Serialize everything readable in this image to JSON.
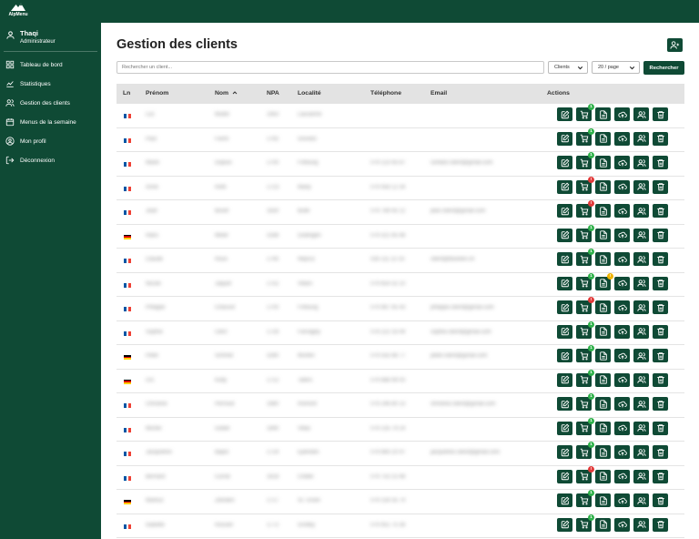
{
  "app": {
    "logo_text": "AlpMenu"
  },
  "user": {
    "name": "Thaqi",
    "role": "Administrateur"
  },
  "nav": [
    {
      "label": "Tableau de bord",
      "icon": "dashboard-icon"
    },
    {
      "label": "Statistiques",
      "icon": "chart-icon"
    },
    {
      "label": "Gestion des clients",
      "icon": "users-icon"
    },
    {
      "label": "Menus de la semaine",
      "icon": "calendar-icon"
    },
    {
      "label": "Mon profil",
      "icon": "profile-icon"
    },
    {
      "label": "Déconnexion",
      "icon": "logout-icon"
    }
  ],
  "page": {
    "title": "Gestion des clients",
    "search_placeholder": "Rechercher un client...",
    "filter_value": "Clients",
    "page_size_value": "20 / page",
    "search_button": "Rechercher"
  },
  "table": {
    "headers": {
      "ln": "Ln",
      "prenom": "Prénom",
      "nom": "Nom",
      "npa": "NPA",
      "localite": "Localité",
      "telephone": "Téléphone",
      "email": "Email",
      "actions": "Actions"
    },
    "sort": {
      "column": "Nom",
      "direction": "asc"
    },
    "colors": {
      "brand": "#0f4a35",
      "badge_green": "#2fb14a",
      "badge_red": "#e23a3a",
      "badge_yellow": "#f0b400"
    },
    "rows": [
      {
        "lang": "fr",
        "prenom": "Luc",
        "nom": "Muller",
        "npa": "1950",
        "localite": "Lausanne",
        "telephone": "",
        "email": "",
        "cart_badge": {
          "color": "green",
          "text": "1"
        },
        "doc_badge": null
      },
      {
        "lang": "fr",
        "prenom": "Paul",
        "nom": "Favre",
        "npa": "1762",
        "localite": "Givisiez",
        "telephone": "",
        "email": "",
        "cart_badge": {
          "color": "green",
          "text": "1"
        },
        "doc_badge": null
      },
      {
        "lang": "fr",
        "prenom": "Marie",
        "nom": "Dupuis",
        "npa": "1700",
        "localite": "Fribourg",
        "telephone": "079 123 45 67",
        "email": "contact.client@gmail.com",
        "cart_badge": {
          "color": "green",
          "text": "1"
        },
        "doc_badge": null
      },
      {
        "lang": "fr",
        "prenom": "Anne",
        "nom": "Roth",
        "npa": "1723",
        "localite": "Marly",
        "telephone": "079 456 12 34",
        "email": "",
        "cart_badge": {
          "color": "red",
          "text": "!"
        },
        "doc_badge": null
      },
      {
        "lang": "fr",
        "prenom": "Jean",
        "nom": "Bovet",
        "npa": "1630",
        "localite": "Bulle",
        "telephone": "079 789 45 12",
        "email": "jean.client@gmail.com",
        "cart_badge": {
          "color": "red",
          "text": "!"
        },
        "doc_badge": null
      },
      {
        "lang": "de",
        "prenom": "Hans",
        "nom": "Meier",
        "npa": "3186",
        "localite": "Düdingen",
        "telephone": "079 321 65 98",
        "email": "",
        "cart_badge": {
          "color": "green",
          "text": "1"
        },
        "doc_badge": null
      },
      {
        "lang": "fr",
        "prenom": "Claude",
        "nom": "Roux",
        "npa": "1740",
        "localite": "Neyruz",
        "telephone": "026 111 22 33",
        "email": "client@bluewin.ch",
        "cart_badge": {
          "color": "green",
          "text": "1"
        },
        "doc_badge": null
      },
      {
        "lang": "fr",
        "prenom": "Nicole",
        "nom": "Jaquet",
        "npa": "1752",
        "localite": "Villars",
        "telephone": "079 654 32 10",
        "email": "",
        "cart_badge": {
          "color": "green",
          "text": "1"
        },
        "doc_badge": {
          "color": "yellow",
          "text": "!"
        }
      },
      {
        "lang": "fr",
        "prenom": "Philippe",
        "nom": "Chassot",
        "npa": "1700",
        "localite": "Fribourg",
        "telephone": "079 987 65 43",
        "email": "philippe.client@gmail.com",
        "cart_badge": {
          "color": "red",
          "text": "!"
        },
        "doc_badge": null
      },
      {
        "lang": "fr",
        "prenom": "Sophie",
        "nom": "Clerc",
        "npa": "1726",
        "localite": "Farvagny",
        "telephone": "078 222 33 44",
        "email": "sophie.client@gmail.com",
        "cart_badge": {
          "color": "green",
          "text": "1"
        },
        "doc_badge": null
      },
      {
        "lang": "de",
        "prenom": "Peter",
        "nom": "Schmid",
        "npa": "3280",
        "localite": "Murten",
        "telephone": "079 555 66 77",
        "email": "peter.client@gmail.com",
        "cart_badge": {
          "color": "green",
          "text": "1"
        },
        "doc_badge": null
      },
      {
        "lang": "de",
        "prenom": "Urs",
        "nom": "Kolly",
        "npa": "1712",
        "localite": "Tafers",
        "telephone": "079 888 99 00",
        "email": "",
        "cart_badge": {
          "color": "green",
          "text": "1"
        },
        "doc_badge": null
      },
      {
        "lang": "fr",
        "prenom": "Christine",
        "nom": "Perroud",
        "npa": "1680",
        "localite": "Romont",
        "telephone": "079 246 80 13",
        "email": "christine.client@gmail.com",
        "cart_badge": {
          "color": "green",
          "text": "1"
        },
        "doc_badge": null
      },
      {
        "lang": "fr",
        "prenom": "Michel",
        "nom": "Gobet",
        "npa": "1690",
        "localite": "Villaz",
        "telephone": "079 135 79 24",
        "email": "",
        "cart_badge": {
          "color": "green",
          "text": "1"
        },
        "doc_badge": null
      },
      {
        "lang": "fr",
        "prenom": "Jacqueline",
        "nom": "Bapst",
        "npa": "1724",
        "localite": "Ependes",
        "telephone": "079 864 20 97",
        "email": "jacqueline.client@gmail.com",
        "cart_badge": {
          "color": "green",
          "text": "1"
        },
        "doc_badge": null
      },
      {
        "lang": "fr",
        "prenom": "Bernard",
        "nom": "Currat",
        "npa": "1618",
        "localite": "Châtel",
        "telephone": "079 753 15 98",
        "email": "",
        "cart_badge": {
          "color": "red",
          "text": "!"
        },
        "doc_badge": null
      },
      {
        "lang": "de",
        "prenom": "Markus",
        "nom": "Zbinden",
        "npa": "1717",
        "localite": "St. Ursen",
        "telephone": "079 159 35 74",
        "email": "",
        "cart_badge": {
          "color": "green",
          "text": "1"
        },
        "doc_badge": null
      },
      {
        "lang": "fr",
        "prenom": "Isabelle",
        "nom": "Rossier",
        "npa": "1772",
        "localite": "Grolley",
        "telephone": "079 951 75 36",
        "email": "",
        "cart_badge": {
          "color": "green",
          "text": "1"
        },
        "doc_badge": null
      }
    ]
  }
}
